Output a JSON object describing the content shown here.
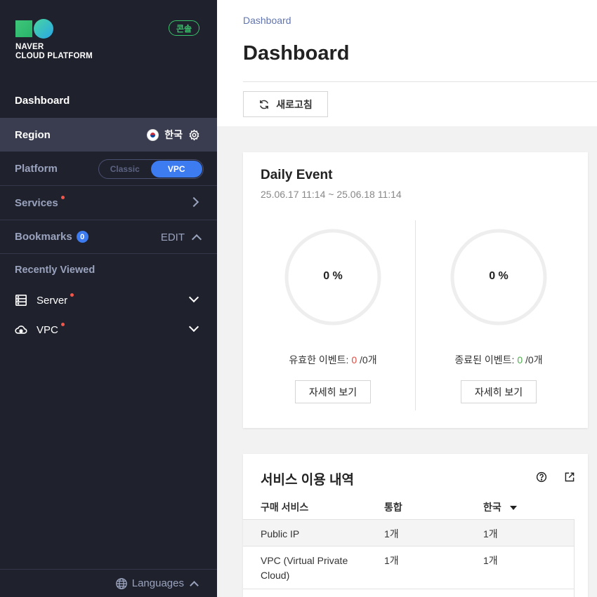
{
  "brand": {
    "line1": "NAVER",
    "line2": "CLOUD PLATFORM",
    "console_badge": "콘솔"
  },
  "sidebar": {
    "dashboard": "Dashboard",
    "region": {
      "label": "Region",
      "value": "한국"
    },
    "platform": {
      "label": "Platform",
      "options": [
        "Classic",
        "VPC"
      ],
      "selected": "VPC"
    },
    "services": {
      "label": "Services"
    },
    "bookmarks": {
      "label": "Bookmarks",
      "count": "0",
      "edit": "EDIT"
    },
    "recently_viewed": {
      "label": "Recently Viewed",
      "items": [
        "Server",
        "VPC"
      ]
    },
    "languages": "Languages"
  },
  "header": {
    "breadcrumb": "Dashboard",
    "title": "Dashboard",
    "refresh_label": "새로고침"
  },
  "daily_event": {
    "title": "Daily Event",
    "range": "25.06.17 11:14 ~ 25.06.18 11:14",
    "valid": {
      "percent": "0 %",
      "label": "유효한 이벤트: ",
      "count": "0",
      "suffix": " /0개",
      "button": "자세히 보기"
    },
    "ended": {
      "percent": "0 %",
      "label": "종료된 이벤트: ",
      "count": "0",
      "suffix": " /0개",
      "button": "자세히 보기"
    }
  },
  "usage": {
    "title": "서비스 이용 내역",
    "columns": [
      "구매 서비스",
      "통합",
      "한국"
    ],
    "rows": [
      {
        "service": "Public IP",
        "total": "1개",
        "korea": "1개"
      },
      {
        "service": "VPC (Virtual Private Cloud)",
        "total": "1개",
        "korea": "1개"
      }
    ]
  },
  "colors": {
    "sidebar_bg": "#1f212d",
    "accent": "#3d7bf0",
    "console_green": "#38c46a",
    "alert_red": "#f0564a"
  }
}
